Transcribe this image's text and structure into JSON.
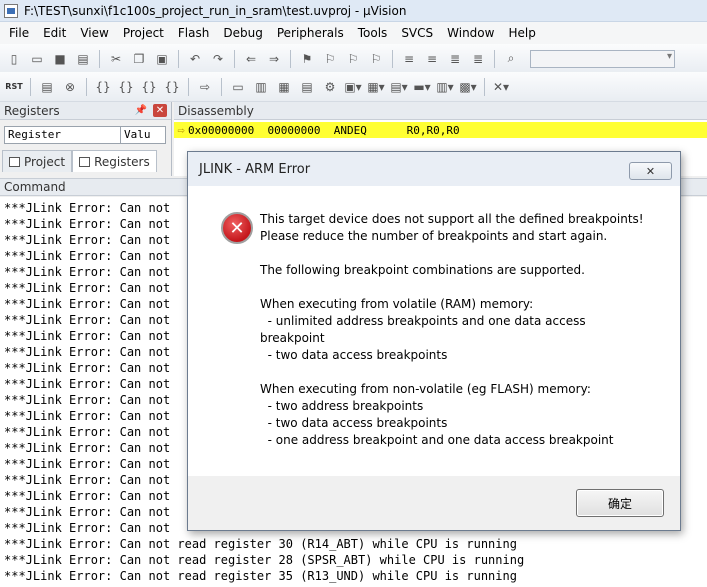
{
  "window": {
    "title": "F:\\TEST\\sunxi\\f1c100s_project_run_in_sram\\test.uvproj - µVision"
  },
  "menu": [
    "File",
    "Edit",
    "View",
    "Project",
    "Flash",
    "Debug",
    "Peripherals",
    "Tools",
    "SVCS",
    "Window",
    "Help"
  ],
  "toolbar": {
    "reset_label": "RST"
  },
  "registers_panel": {
    "title": "Registers",
    "col_register": "Register",
    "col_value": "Valu",
    "tabs": [
      "Project",
      "Registers"
    ]
  },
  "disassembly": {
    "title": "Disassembly",
    "address": "0x00000000",
    "opcode": "00000000",
    "mnemonic": "ANDEQ",
    "operands": "R0,R0,R0"
  },
  "command": {
    "title": "Command",
    "lines": [
      "***JLink Error: Can not",
      "***JLink Error: Can not",
      "***JLink Error: Can not",
      "***JLink Error: Can not",
      "***JLink Error: Can not",
      "***JLink Error: Can not",
      "***JLink Error: Can not",
      "***JLink Error: Can not",
      "***JLink Error: Can not",
      "***JLink Error: Can not",
      "***JLink Error: Can not",
      "***JLink Error: Can not",
      "***JLink Error: Can not",
      "***JLink Error: Can not",
      "***JLink Error: Can not",
      "***JLink Error: Can not",
      "***JLink Error: Can not",
      "***JLink Error: Can not",
      "***JLink Error: Can not",
      "***JLink Error: Can not",
      "***JLink Error: Can not",
      "***JLink Error: Can not",
      "***JLink Error: Can not",
      "***JLink Error: Can not",
      "***JLink Error: Can not",
      "***JLink Error: Can not",
      "***JLink Error: Can not",
      "***JLink Error: Can not",
      "***JLink Error: Can not",
      "***JLink Error: Can not",
      "***JLink Error: Can not read register 30 (R14_ABT) while CPU is running",
      "***JLink Error: Can not read register 28 (SPSR_ABT) while CPU is running",
      "***JLink Error: Can not read register 35 (R13_UND) while CPU is running"
    ]
  },
  "dialog": {
    "title": "JLINK - ARM Error",
    "close_label": "✕",
    "message_lines": [
      "This target device does not support all the defined breakpoints!",
      "Please reduce the number of breakpoints and start again.",
      "",
      "The following breakpoint combinations are supported.",
      "",
      "When executing from volatile (RAM) memory:",
      "  - unlimited address breakpoints and one data access",
      "breakpoint",
      "  - two data access breakpoints",
      "",
      "When executing from non-volatile (eg FLASH) memory:",
      "  - two address breakpoints",
      "  - two data access breakpoints",
      "  - one address breakpoint and one data access breakpoint"
    ],
    "ok_label": "确定"
  }
}
